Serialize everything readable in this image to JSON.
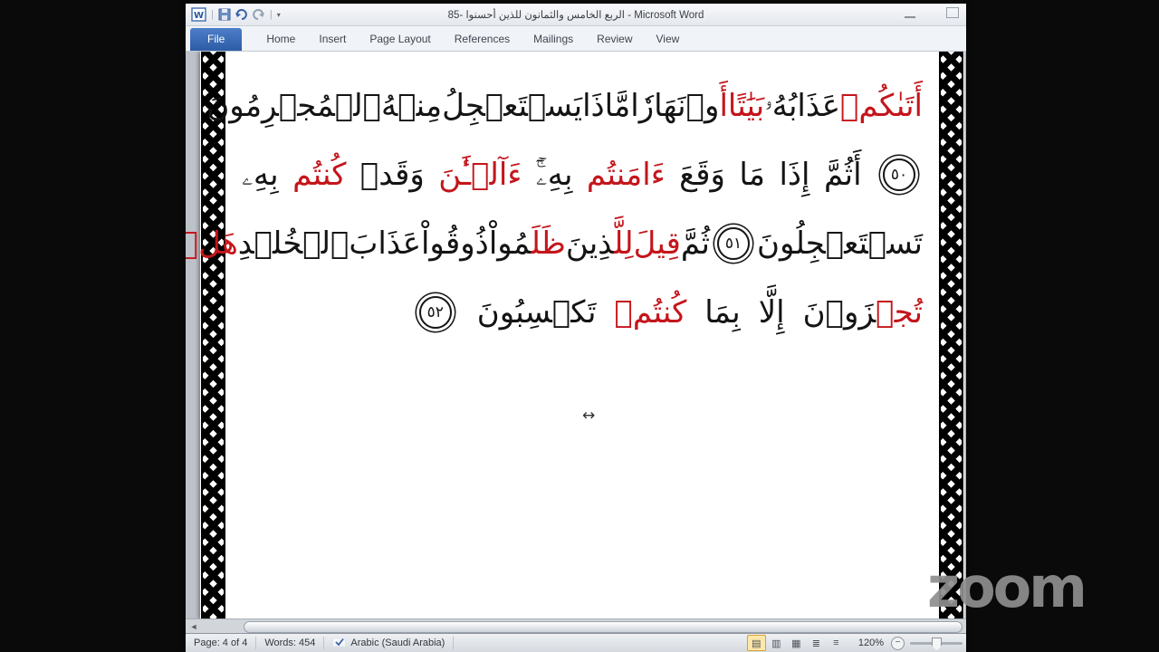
{
  "titlebar": {
    "document_title": "الربع الخامس والثمانون للذين أحسنوا -85",
    "app_name": " - Microsoft Word"
  },
  "ribbon": {
    "tabs": [
      "File",
      "Home",
      "Insert",
      "Page Layout",
      "References",
      "Mailings",
      "Review",
      "View"
    ]
  },
  "document": {
    "lines": [
      {
        "fill": true,
        "words": [
          {
            "parts": [
              {
                "t": "أَتَىٰكُمۡ",
                "red": true
              }
            ]
          },
          {
            "parts": [
              {
                "t": "عَذَابُهُۥ"
              }
            ]
          },
          {
            "parts": [
              {
                "t": "بَيَٰتًا",
                "red": true
              }
            ]
          },
          {
            "parts": [
              {
                "t": "أَ",
                "red": true
              },
              {
                "t": "وۡ"
              }
            ]
          },
          {
            "parts": [
              {
                "t": "نَهَارٗا"
              }
            ]
          },
          {
            "parts": [
              {
                "t": "مَّاذَا"
              }
            ]
          },
          {
            "parts": [
              {
                "t": "يَسۡتَعۡجِلُ"
              }
            ]
          },
          {
            "parts": [
              {
                "t": "مِنۡهُ"
              }
            ]
          },
          {
            "parts": [
              {
                "t": "ٱلۡمُجۡرِمُونَ"
              }
            ]
          }
        ]
      },
      {
        "fill": true,
        "words": [
          {
            "verse": "٥٠"
          },
          {
            "parts": [
              {
                "t": "أَثُمَّ"
              }
            ]
          },
          {
            "parts": [
              {
                "t": "إِذَا"
              }
            ]
          },
          {
            "parts": [
              {
                "t": "مَا"
              }
            ]
          },
          {
            "parts": [
              {
                "t": "وَقَعَ"
              }
            ]
          },
          {
            "parts": [
              {
                "t": "ءَامَنتُم",
                "red": true
              }
            ]
          },
          {
            "parts": [
              {
                "t": "بِهِۦٓۚ"
              }
            ]
          },
          {
            "parts": [
              {
                "t": "ءَآلۡـَٰٔنَ",
                "red": true
              }
            ]
          },
          {
            "parts": [
              {
                "t": "وَقَدۡ"
              }
            ]
          },
          {
            "parts": [
              {
                "t": "كُنتُم",
                "red": true
              }
            ]
          },
          {
            "parts": [
              {
                "t": "بِهِۦ"
              }
            ]
          }
        ]
      },
      {
        "fill": true,
        "words": [
          {
            "parts": [
              {
                "t": "تَسۡتَعۡجِلُونَ"
              }
            ]
          },
          {
            "verse": "٥١"
          },
          {
            "parts": [
              {
                "t": "ثُمَّ"
              }
            ]
          },
          {
            "parts": [
              {
                "t": "قِيلَ",
                "red": true
              }
            ]
          },
          {
            "parts": [
              {
                "t": "لِلَّ",
                "red": true
              },
              {
                "t": "ذِينَ"
              }
            ]
          },
          {
            "parts": [
              {
                "t": "ظَلَ",
                "red": true
              },
              {
                "t": "مُواْ"
              }
            ]
          },
          {
            "parts": [
              {
                "t": "ذُوقُواْ"
              }
            ]
          },
          {
            "parts": [
              {
                "t": "عَذَابَ"
              }
            ]
          },
          {
            "parts": [
              {
                "t": "ٱلۡخُلۡدِ"
              }
            ]
          },
          {
            "parts": [
              {
                "t": "هَلۡ",
                "red": true
              }
            ]
          }
        ]
      },
      {
        "fill": false,
        "words": [
          {
            "parts": [
              {
                "t": "تُجۡ",
                "red": true
              },
              {
                "t": "زَوۡنَ"
              }
            ]
          },
          {
            "parts": [
              {
                "t": "إِلَّا"
              }
            ]
          },
          {
            "parts": [
              {
                "t": "بِمَا"
              }
            ]
          },
          {
            "parts": [
              {
                "t": "كُنتُمۡ",
                "red": true
              }
            ]
          },
          {
            "parts": [
              {
                "t": "تَكۡسِبُونَ"
              }
            ]
          },
          {
            "verse": "٥٢"
          }
        ]
      }
    ]
  },
  "status": {
    "page": "Page: 4 of 4",
    "words": "Words: 454",
    "language": "Arabic (Saudi Arabia)",
    "zoom_level": "120%"
  },
  "view_icons": {
    "print_layout": "▤",
    "full_screen_reading": "▥",
    "web_layout": "▦",
    "outline": "≣",
    "draft": "≡"
  },
  "scroll": {
    "left_arrow": "◄"
  },
  "cursor": {
    "glyph": "↔"
  },
  "watermark": {
    "text": "zoom"
  },
  "colors": {
    "text_red": "#c4151b",
    "text_black": "#141414",
    "file_tab_blue": "#2d5ca6",
    "view_active_highlight": "#fde8a9"
  }
}
